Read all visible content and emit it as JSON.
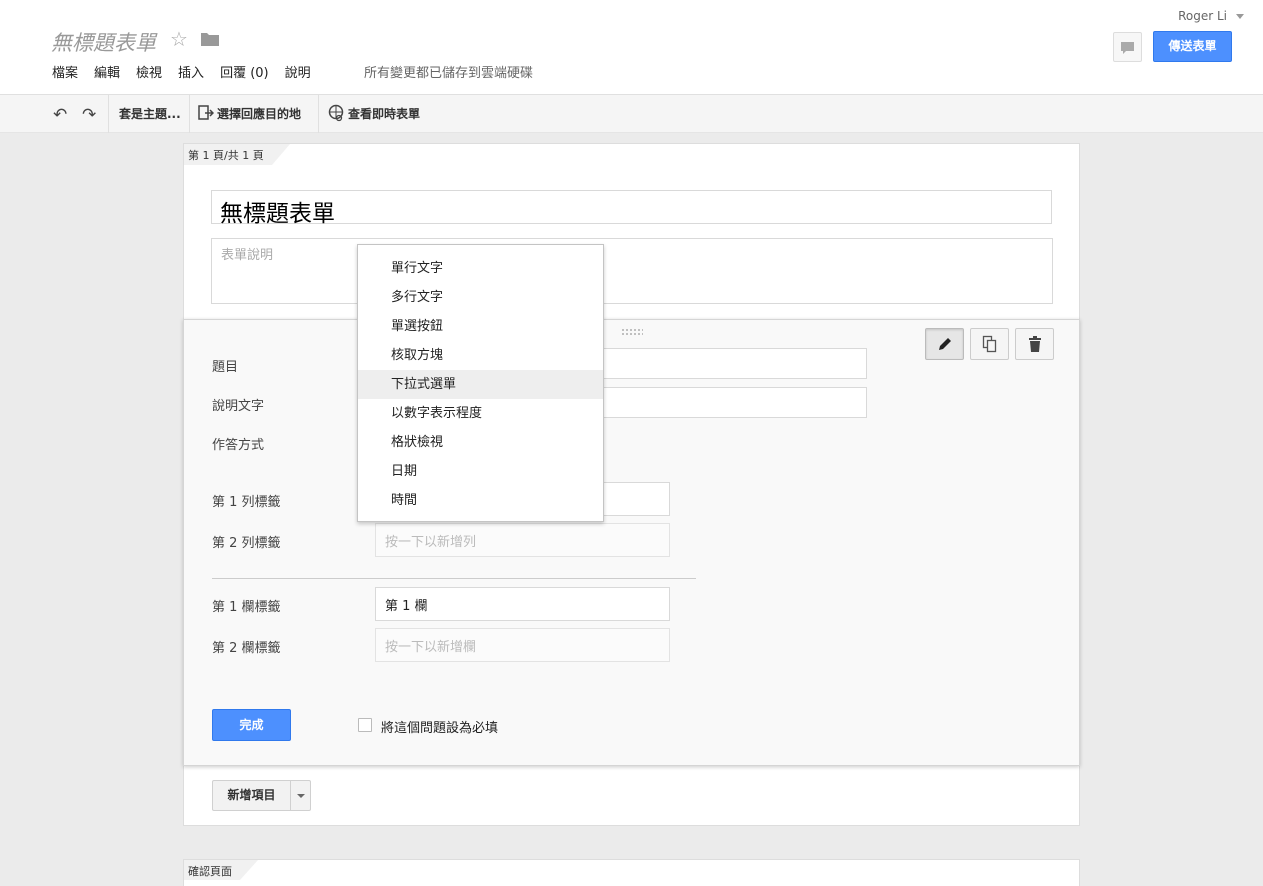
{
  "header": {
    "title": "無標題表單",
    "user": "Roger Li",
    "send_label": "傳送表單",
    "save_status": "所有變更都已儲存到雲端硬碟",
    "menu": [
      "檔案",
      "編輯",
      "檢視",
      "插入",
      "回覆 (0)",
      "說明"
    ]
  },
  "toolbar": {
    "theme_label": "套是主題...",
    "dest_label": "選擇回應目的地",
    "live_label": "查看即時表單"
  },
  "page": {
    "tab_label": "第 1 頁/共 1 頁",
    "form_title": "無標題表單",
    "form_desc_placeholder": "表單說明"
  },
  "item": {
    "question_label": "題目",
    "help_label": "說明文字",
    "type_label": "作答方式",
    "row1_label": "第 1 列標籤",
    "row2_label": "第 2 列標籤",
    "row2_placeholder": "按一下以新增列",
    "col1_label": "第 1 欄標籤",
    "col1_value": "第 1 欄",
    "col2_label": "第 2 欄標籤",
    "col2_placeholder": "按一下以新增欄",
    "done_label": "完成",
    "required_label": "將這個問題設為必填"
  },
  "add_item_label": "新增項目",
  "confirm_tab": "確認頁面",
  "question_types": [
    "單行文字",
    "多行文字",
    "單選按鈕",
    "核取方塊",
    "下拉式選單",
    "以數字表示程度",
    "格狀檢視",
    "日期",
    "時間"
  ],
  "highlighted_type": "下拉式選單",
  "colors": {
    "primary": "#4d90fe",
    "background": "#ebebeb"
  }
}
